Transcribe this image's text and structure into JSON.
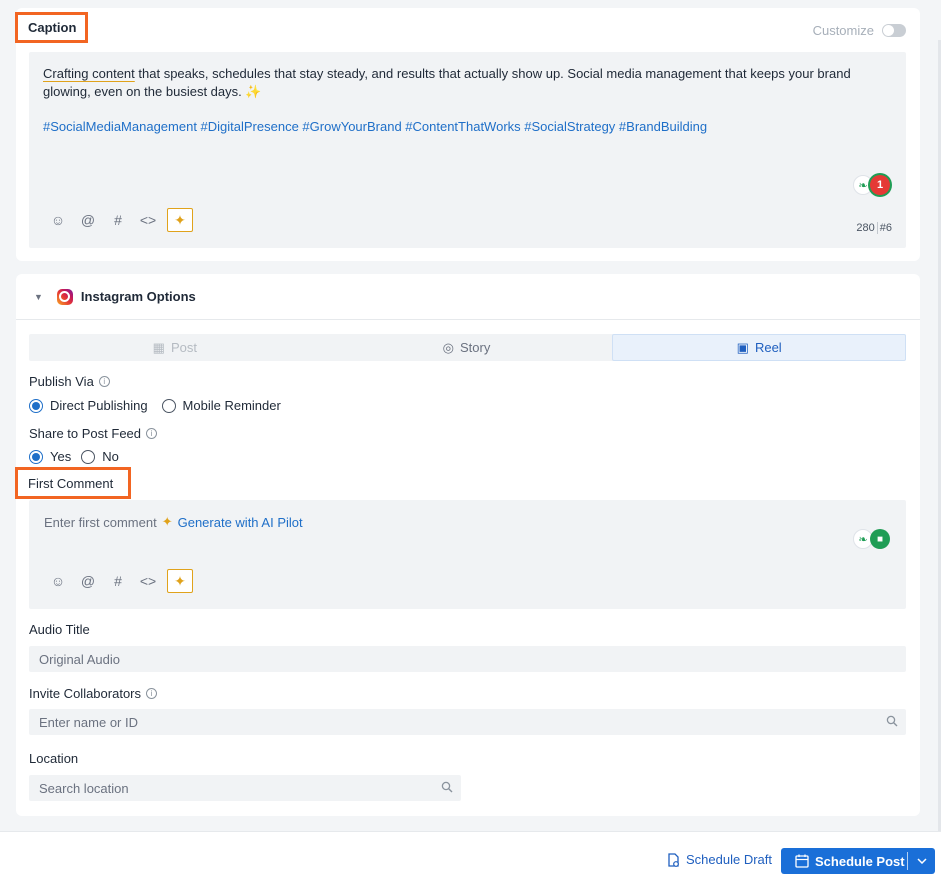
{
  "caption": {
    "title": "Caption",
    "customize_label": "Customize",
    "text_part1": "Crafting content",
    "text_part2": " that speaks, schedules that stay steady, and results that actually show up. Social media management that keeps your brand glowing, even on the busiest days. ✨",
    "hashtags": "#SocialMediaManagement #DigitalPresence #GrowYourBrand #ContentThatWorks #SocialStrategy #BrandBuilding",
    "char_count": "280",
    "hashtag_count": "#6",
    "issue_count": "1"
  },
  "toolbar": {
    "emoji": "☺",
    "mention": "@",
    "hashtag": "#",
    "code": "<>",
    "ai": "✦"
  },
  "instagram": {
    "title": "Instagram Options",
    "tabs": [
      {
        "label": "Post",
        "state": "disabled"
      },
      {
        "label": "Story",
        "state": "normal"
      },
      {
        "label": "Reel",
        "state": "active"
      }
    ],
    "publish_via": {
      "label": "Publish Via",
      "options": [
        "Direct Publishing",
        "Mobile Reminder"
      ],
      "selected": "Direct Publishing"
    },
    "share_to_feed": {
      "label": "Share to Post Feed",
      "options": [
        "Yes",
        "No"
      ],
      "selected": "Yes"
    },
    "first_comment": {
      "label": "First Comment",
      "placeholder": "Enter first comment",
      "ai_link": "Generate with AI Pilot"
    },
    "audio_title": {
      "label": "Audio Title",
      "value": "Original Audio"
    },
    "collaborators": {
      "label": "Invite Collaborators",
      "placeholder": "Enter name or ID"
    },
    "location": {
      "label": "Location",
      "placeholder": "Search location"
    }
  },
  "actions": {
    "draft": "Schedule Draft",
    "post": "Schedule Post"
  },
  "colors": {
    "highlight": "#f26522",
    "link": "#1f6fc8",
    "primary": "#1a6fd8",
    "ai": "#e0a21b"
  }
}
